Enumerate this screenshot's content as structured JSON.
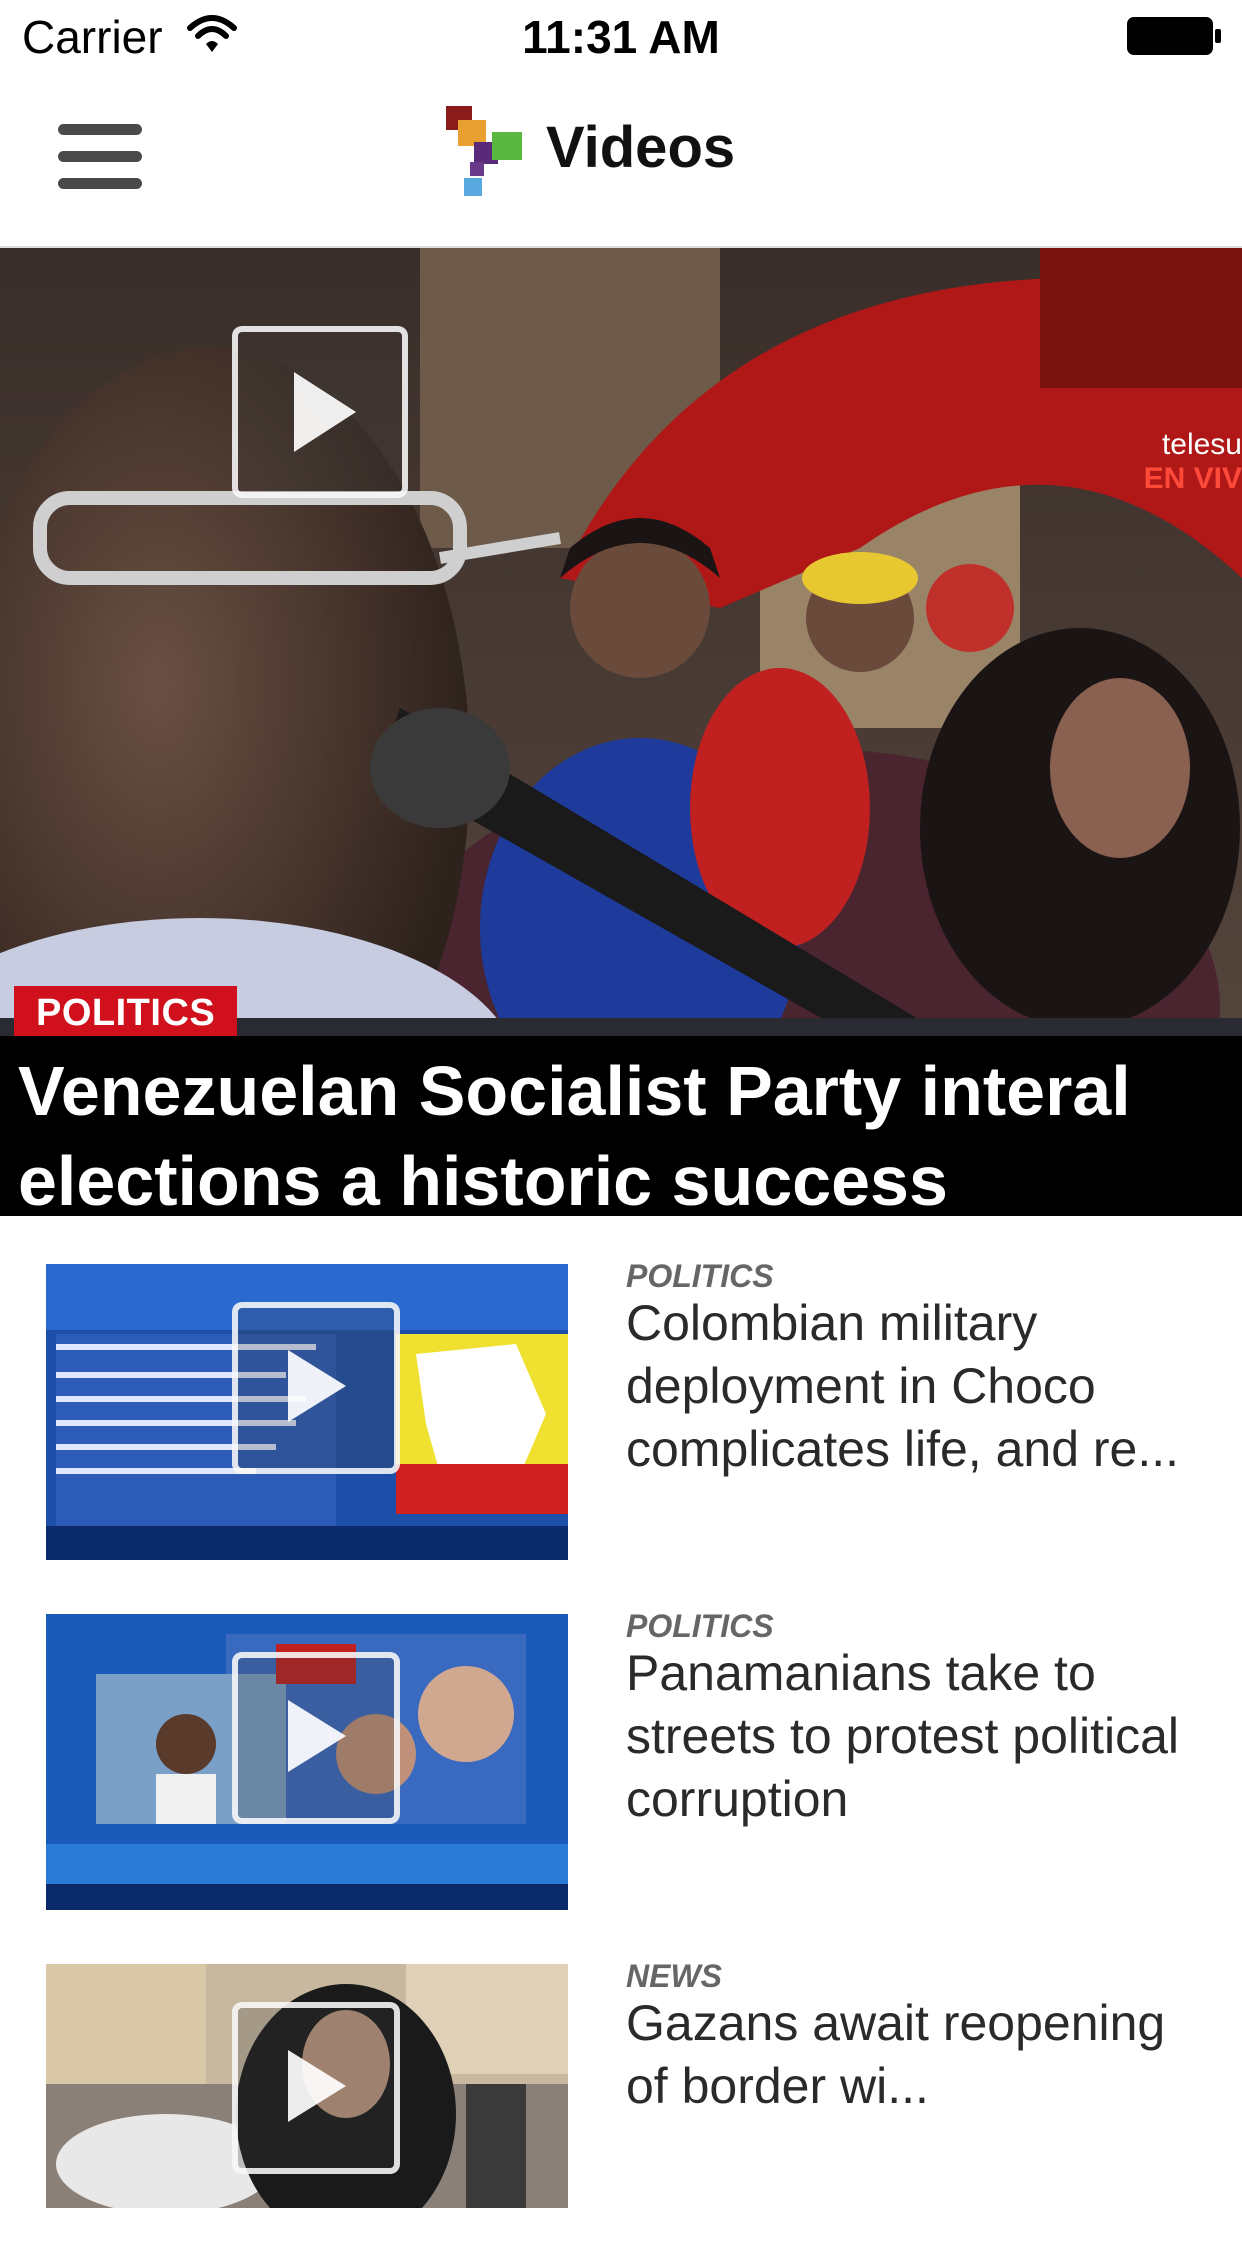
{
  "status_bar": {
    "carrier": "Carrier",
    "time": "11:31 AM"
  },
  "nav": {
    "title": "Videos",
    "menu_icon": "hamburger-icon",
    "logo_icon": "telesur-logo-icon"
  },
  "hero": {
    "category": "POLITICS",
    "title": "Venezuelan Socialist Party interal elections a historic success",
    "watermark": "telesu",
    "watermark_live": "EN VIV",
    "category_color": "#d0101c"
  },
  "items": [
    {
      "category": "POLITICS",
      "title": "Colombian military deployment in Choco complicates life, and re..."
    },
    {
      "category": "POLITICS",
      "title": "Panamanians take to streets to protest political corruption"
    },
    {
      "category": "NEWS",
      "title": "Gazans await reopening of border wi..."
    }
  ]
}
